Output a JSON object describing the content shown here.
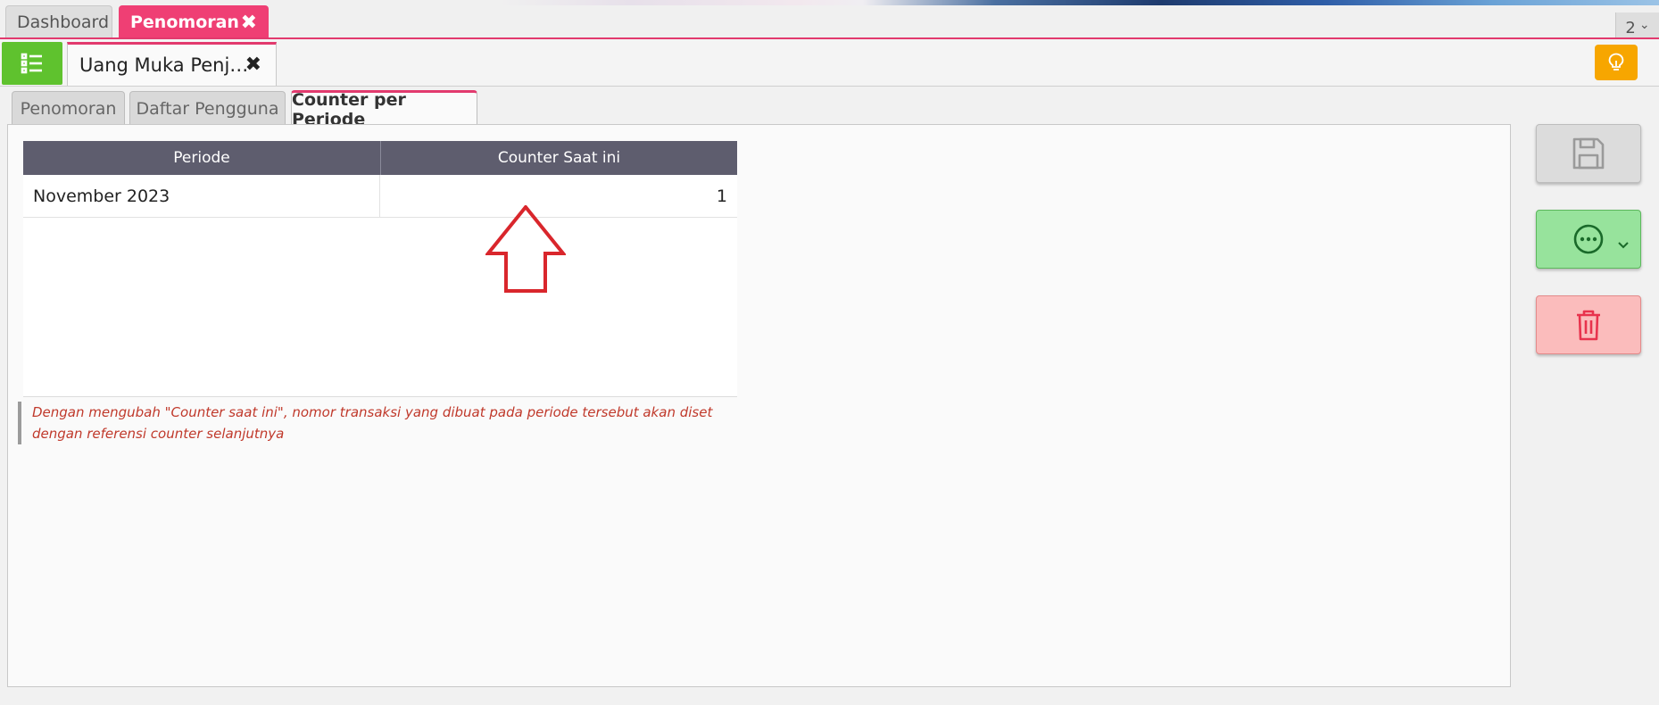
{
  "top_tabs": {
    "dashboard": "Dashboard",
    "penomoran": "Penomoran",
    "close_glyph": "✖",
    "count": "2",
    "count_chevron": "⌄"
  },
  "doc_tab": {
    "title": "Uang Muka Penj…",
    "close_glyph": "✖"
  },
  "inner_tabs": [
    "Penomoran",
    "Daftar Pengguna",
    "Counter per Periode"
  ],
  "grid": {
    "columns": [
      "Periode",
      "Counter Saat ini"
    ],
    "rows": [
      {
        "periode": "November 2023",
        "counter": "1"
      }
    ]
  },
  "note": "Dengan mengubah \"Counter saat ini\", nomor transaksi yang dibuat pada periode tersebut akan diset dengan referensi counter selanjutnya",
  "icons": {
    "list": "list-icon",
    "bulb": "lightbulb-icon",
    "save": "save-icon",
    "more": "more-icon",
    "delete": "trash-icon",
    "arrow": "arrow-up-annotation"
  },
  "colors": {
    "accent": "#e23a6e",
    "tab_active": "#ef3f74",
    "green": "#5fc22e",
    "orange": "#f7a600",
    "header": "#5e5d6e",
    "note_text": "#c0392b",
    "arrow": "#d9262c"
  }
}
